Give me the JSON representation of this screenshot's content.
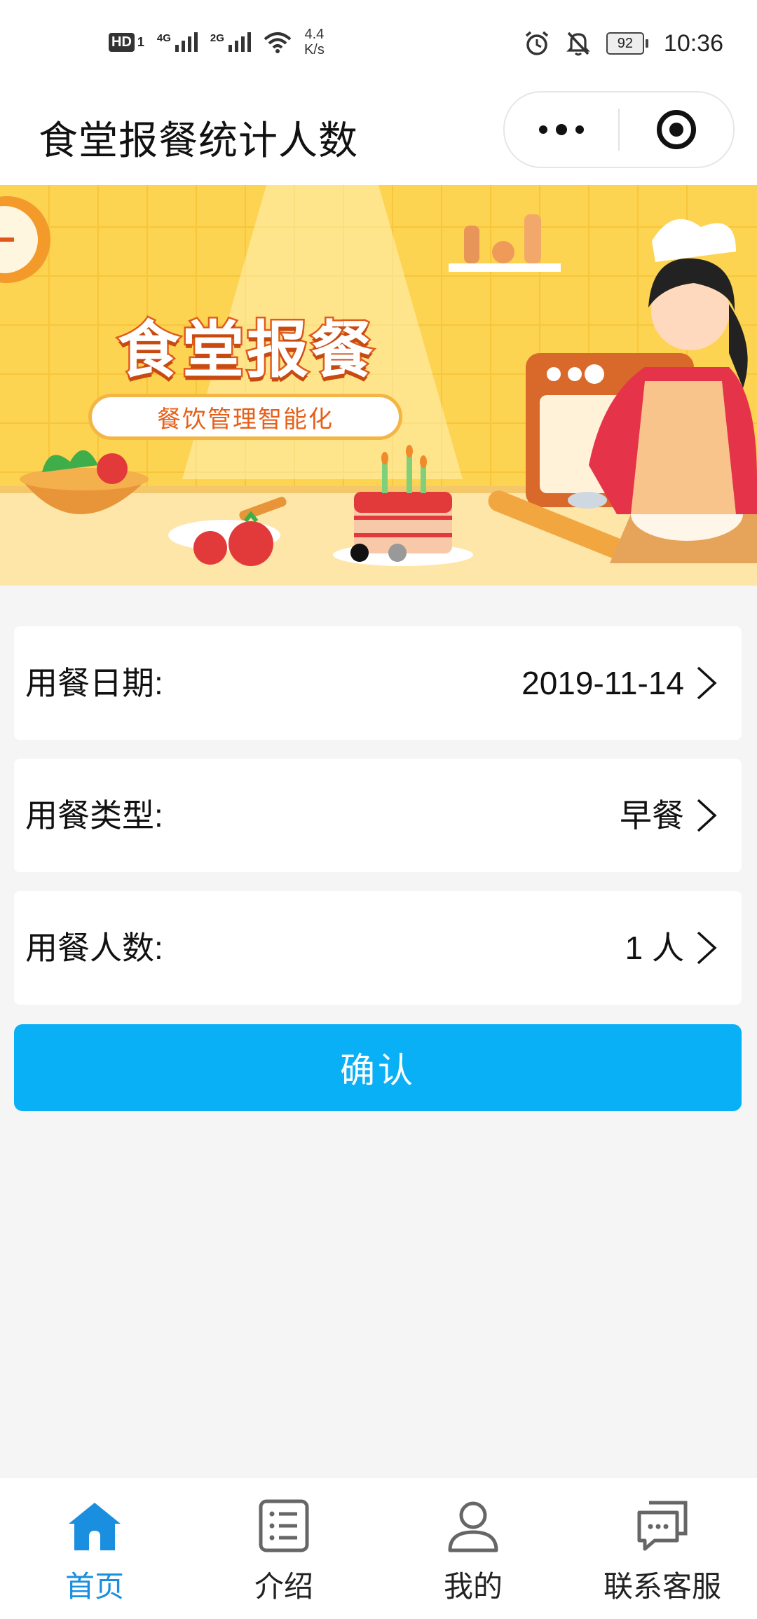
{
  "status_bar": {
    "hd_label": "HD",
    "sim_label": "1",
    "network_1": "4G",
    "network_2": "2G",
    "speed_value": "4.4",
    "speed_unit": "K/s",
    "battery": "92",
    "time": "10:36",
    "icons": [
      "alarm-icon",
      "mute-icon",
      "wifi-icon",
      "battery-icon"
    ]
  },
  "title_bar": {
    "title": "食堂报餐统计人数",
    "menu_icon": "more-dots-icon",
    "close_icon": "target-icon"
  },
  "banner": {
    "title": "食堂报餐",
    "subtitle": "餐饮管理智能化",
    "slide_count": 2,
    "active_slide": 1,
    "colors": {
      "background": "#fdd352",
      "accent": "#e25b1c"
    }
  },
  "form": {
    "rows": [
      {
        "label": "用餐日期:",
        "value": "2019-11-14"
      },
      {
        "label": "用餐类型:",
        "value": "早餐"
      },
      {
        "label": "用餐人数:",
        "value": "1 人"
      }
    ],
    "confirm_label": "确认",
    "confirm_color": "#0ab0f6"
  },
  "tab_bar": {
    "active_color": "#1a8fdf",
    "items": [
      {
        "label": "首页",
        "icon": "home-icon",
        "active": true
      },
      {
        "label": "介绍",
        "icon": "list-icon",
        "active": false
      },
      {
        "label": "我的",
        "icon": "user-icon",
        "active": false
      },
      {
        "label": "联系客服",
        "icon": "chat-icon",
        "active": false
      }
    ]
  }
}
